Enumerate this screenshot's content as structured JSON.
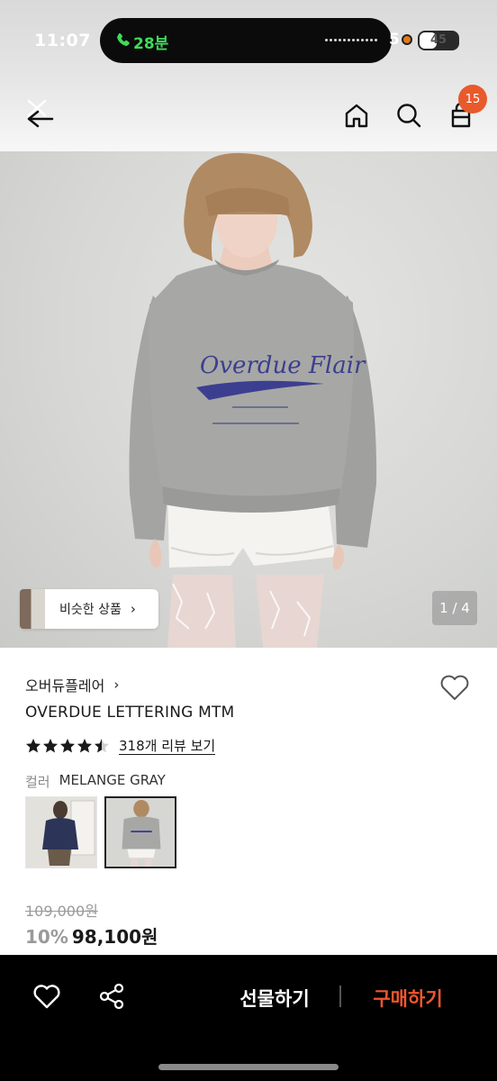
{
  "status_bar": {
    "time": "11:07",
    "call_duration": "28분",
    "signal_text": "5",
    "battery_level": "45"
  },
  "nav": {
    "back_icon": "back-arrow-icon",
    "home_icon": "home-icon",
    "search_icon": "search-icon",
    "cart_icon": "shopping-bag-icon",
    "cart_count": "15"
  },
  "hero": {
    "print_text": "Overdue Flair",
    "similar_products_label": "비슷한 상품",
    "similar_chevron": "›",
    "image_counter": "1 / 4"
  },
  "product": {
    "brand": "오버듀플레어",
    "brand_chevron": "›",
    "title": "OVERDUE LETTERING MTM",
    "rating": 4.5,
    "review_text": "318개 리뷰 보기",
    "color_label": "컬러",
    "color_value": "MELANGE GRAY",
    "swatches": [
      "navy",
      "melange-gray"
    ],
    "original_price": "109,000원",
    "discount": "10%",
    "price": "98,100원"
  },
  "bottom_bar": {
    "gift_label": "선물하기",
    "buy_label": "구매하기"
  },
  "colors": {
    "accent": "#f0562f",
    "badge": "#e85a2c",
    "call_green": "#3ddc5a"
  }
}
